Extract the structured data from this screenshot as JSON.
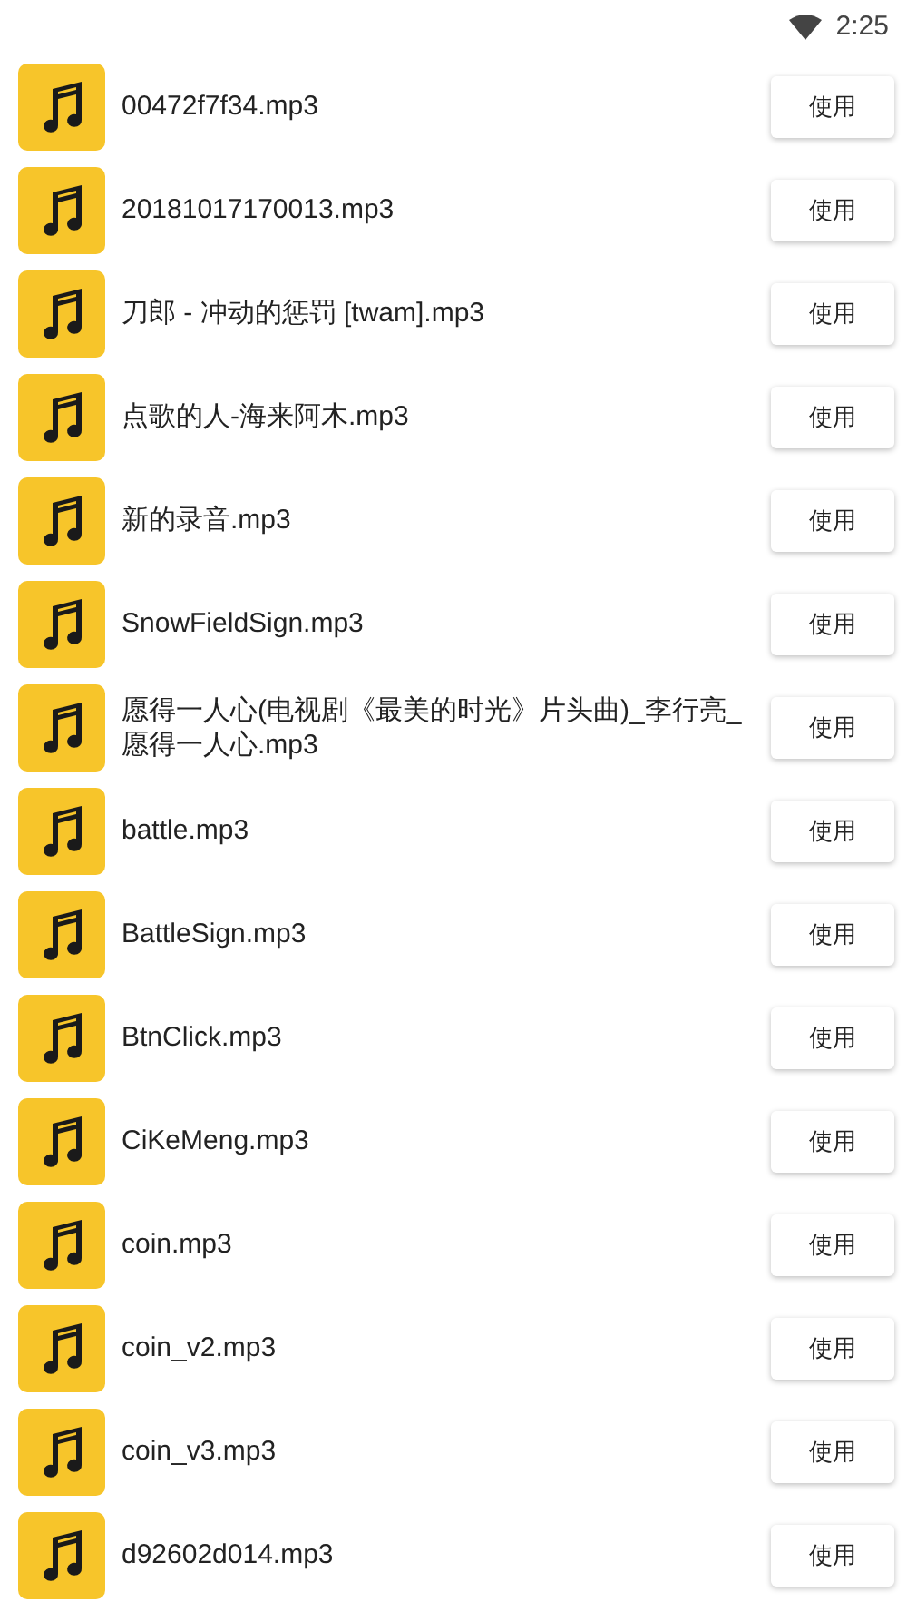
{
  "status_bar": {
    "time": "2:25"
  },
  "files": [
    {
      "name": "00472f7f34.mp3",
      "button": "使用"
    },
    {
      "name": "20181017170013.mp3",
      "button": "使用"
    },
    {
      "name": "刀郎 - 冲动的惩罚 [twam].mp3",
      "button": "使用"
    },
    {
      "name": "点歌的人-海来阿木.mp3",
      "button": "使用"
    },
    {
      "name": "新的录音.mp3",
      "button": "使用"
    },
    {
      "name": "SnowFieldSign.mp3",
      "button": "使用"
    },
    {
      "name": "愿得一人心(电视剧《最美的时光》片头曲)_李行亮_愿得一人心.mp3",
      "button": "使用"
    },
    {
      "name": "battle.mp3",
      "button": "使用"
    },
    {
      "name": "BattleSign.mp3",
      "button": "使用"
    },
    {
      "name": "BtnClick.mp3",
      "button": "使用"
    },
    {
      "name": "CiKeMeng.mp3",
      "button": "使用"
    },
    {
      "name": "coin.mp3",
      "button": "使用"
    },
    {
      "name": "coin_v2.mp3",
      "button": "使用"
    },
    {
      "name": "coin_v3.mp3",
      "button": "使用"
    },
    {
      "name": "d92602d014.mp3",
      "button": "使用"
    }
  ]
}
